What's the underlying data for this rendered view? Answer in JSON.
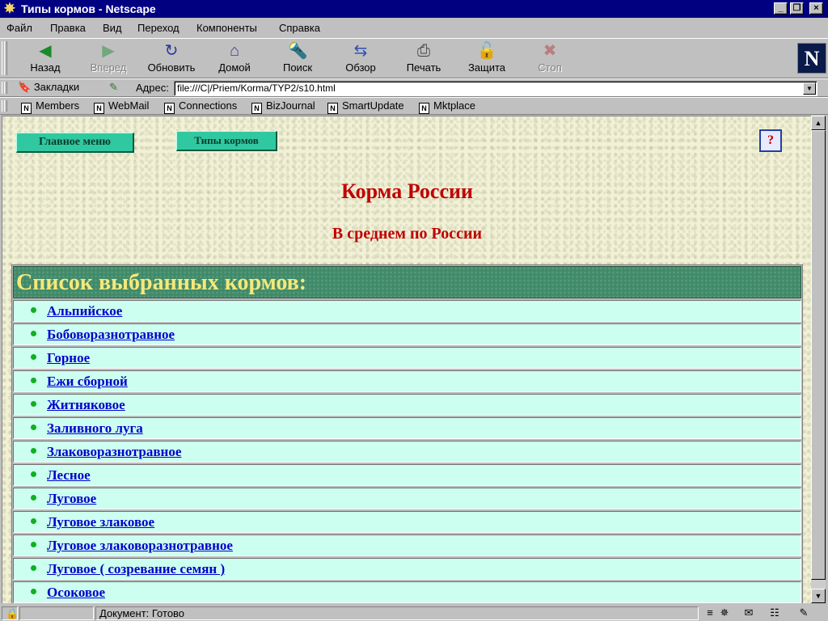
{
  "window": {
    "title": "Типы кормов - Netscape",
    "minimize_label": "_",
    "restore_label": "❐",
    "close_label": "×"
  },
  "menu": {
    "file": "Файл",
    "edit": "Правка",
    "view": "Вид",
    "go": "Переход",
    "components": "Компоненты",
    "help": "Справка"
  },
  "toolbar": {
    "back": "Назад",
    "forward": "Вперед",
    "reload": "Обновить",
    "home": "Домой",
    "search": "Поиск",
    "guide": "Обзор",
    "print": "Печать",
    "security": "Защита",
    "stop": "Стоп",
    "forward_disabled": true,
    "stop_disabled": true
  },
  "location": {
    "bookmarks_label": "Закладки",
    "address_label": "Адрес:",
    "url": "file:///C|/Priem/Korma/TYP2/s10.html"
  },
  "personal_toolbar": [
    "Members",
    "WebMail",
    "Connections",
    "BizJournal",
    "SmartUpdate",
    "Mktplace"
  ],
  "page": {
    "main_menu_button": "Главное меню",
    "feed_types_button": "Типы кормов",
    "heading": "Корма России",
    "subheading": "В среднем по России",
    "list_header": "Список выбранных кормов:",
    "feeds": [
      "Альпийское",
      "Бобоворазнотравное",
      "Горное",
      "Ежи сборной",
      "Житняковое",
      "Заливного луга",
      "Злаковоразнотравное",
      "Лесное",
      "Луговое",
      "Луговое злаковое",
      "Луговое злаковоразнотравное",
      "Луговое ( созревание семян )",
      "Осоковое"
    ]
  },
  "status": {
    "text": "Документ: Готово"
  },
  "colors": {
    "titlebar": "#000080",
    "heading": "#c00000",
    "list_header_bg": "#3f8a68",
    "list_header_text": "#f6e87a",
    "row_bg": "#ccfff0",
    "link": "#0000cc",
    "nav_button": "#30c8a0"
  }
}
